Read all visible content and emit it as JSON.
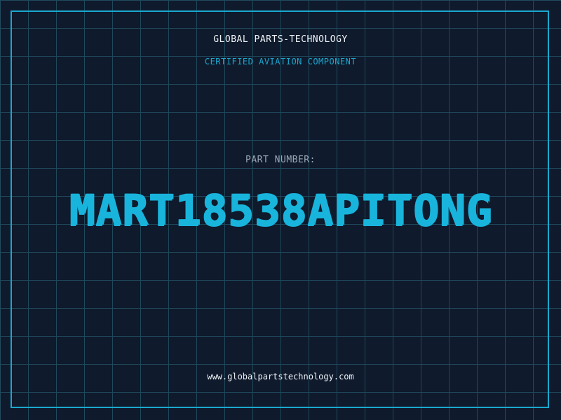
{
  "label": {
    "company": "GLOBAL PARTS-TECHNOLOGY",
    "subtitle": "CERTIFIED AVIATION COMPONENT",
    "part_label": "PART NUMBER:",
    "part_number": "MART18538APITONG",
    "website": "www.globalpartstechnology.com"
  },
  "colors": {
    "background": "#0f1a2c",
    "grid": "#1f4a5c",
    "accent": "#18b4dc",
    "text_light": "#eef3f7",
    "text_muted": "#9aa8b6"
  }
}
